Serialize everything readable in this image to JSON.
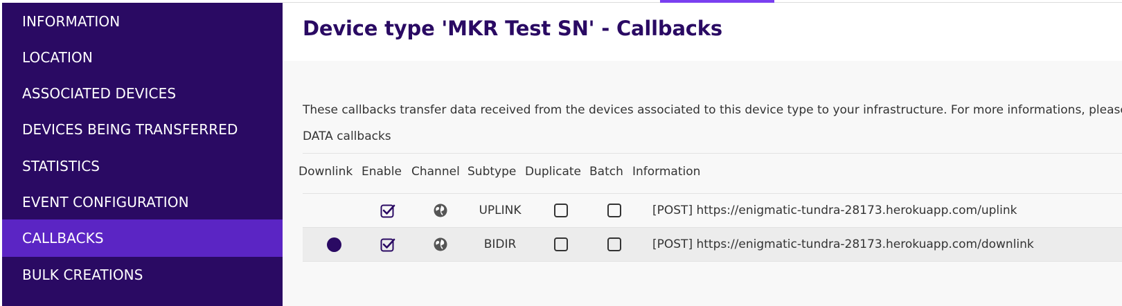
{
  "sidebar": {
    "items": [
      {
        "label": "INFORMATION",
        "active": false
      },
      {
        "label": "LOCATION",
        "active": false
      },
      {
        "label": "ASSOCIATED DEVICES",
        "active": false
      },
      {
        "label": "DEVICES BEING TRANSFERRED",
        "active": false
      },
      {
        "label": "STATISTICS",
        "active": false
      },
      {
        "label": "EVENT CONFIGURATION",
        "active": false
      },
      {
        "label": "CALLBACKS",
        "active": true
      },
      {
        "label": "BULK CREATIONS",
        "active": false
      }
    ]
  },
  "header": {
    "title": "Device type 'MKR Test SN' - Callbacks"
  },
  "main": {
    "description": "These callbacks transfer data received from the devices associated to this device type to your infrastructure. For more informations, please refe",
    "section_label": "DATA callbacks",
    "columns": [
      "Downlink",
      "Enable",
      "Channel",
      "Subtype",
      "Duplicate",
      "Batch",
      "Information"
    ],
    "rows": [
      {
        "downlink": false,
        "enabled": true,
        "channel_icon": "globe-icon",
        "subtype": "UPLINK",
        "duplicate": false,
        "batch": false,
        "information": "[POST] https://enigmatic-tundra-28173.herokuapp.com/uplink"
      },
      {
        "downlink": true,
        "enabled": true,
        "channel_icon": "globe-icon",
        "subtype": "BIDIR",
        "duplicate": false,
        "batch": false,
        "information": "[POST] https://enigmatic-tundra-28173.herokuapp.com/downlink"
      }
    ]
  },
  "colors": {
    "sidebar_bg": "#2a0a63",
    "sidebar_active": "#5b25c4",
    "accent": "#7a3ff0",
    "title": "#2a0a63"
  }
}
